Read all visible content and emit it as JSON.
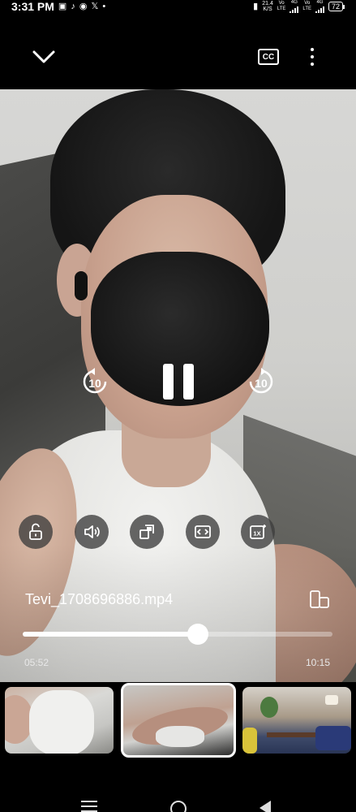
{
  "status_bar": {
    "time": "3:31 PM",
    "notification_icons": [
      "gallery-icon",
      "tiktok-icon",
      "messenger-icon",
      "x-icon",
      "dot-icon"
    ],
    "net_speed_value": "21.4",
    "net_speed_unit": "K/S",
    "sim1_top": "Vo",
    "sim1_bottom": "LTE",
    "sim1_network": "4G",
    "sim2_top": "Vo",
    "sim2_bottom": "LTE",
    "sim2_network": "4G",
    "battery": "72"
  },
  "top_bar": {
    "cc_label": "CC"
  },
  "player": {
    "skip_back_seconds": "10",
    "skip_forward_seconds": "10",
    "state": "playing",
    "filename": "Tevi_1708696886.mp4",
    "current_time": "05:52",
    "total_time": "10:15",
    "progress_fraction": 0.565,
    "speed_label": "1X"
  },
  "tools": [
    "lock-icon",
    "volume-icon",
    "popup-player-icon",
    "screen-fit-icon",
    "playback-speed-icon"
  ],
  "thumbnails": [
    {
      "name": "thumbnail-1",
      "selected": false
    },
    {
      "name": "thumbnail-2",
      "selected": true
    },
    {
      "name": "thumbnail-3",
      "selected": false
    }
  ],
  "nav_bar": {
    "buttons": [
      "recents-icon",
      "home-icon",
      "back-icon"
    ]
  }
}
